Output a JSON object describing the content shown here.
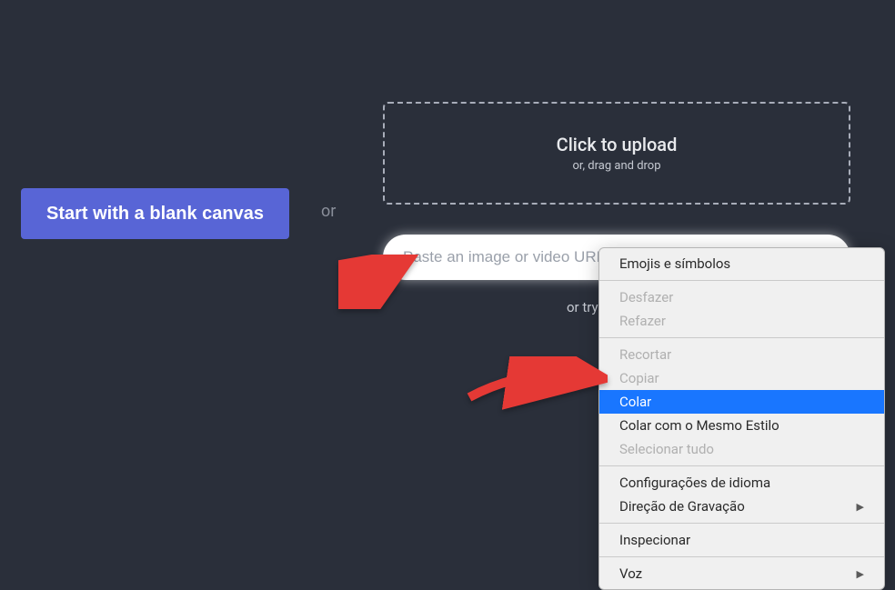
{
  "blank_canvas_label": "Start with a blank canvas",
  "or_label": "or",
  "upload": {
    "title": "Click to upload",
    "subtitle": "or, drag and drop"
  },
  "url_input_placeholder": "Paste an image or video URL",
  "or_try_label": "or try",
  "context_menu": {
    "emojis": "Emojis e símbolos",
    "desfazer": "Desfazer",
    "refazer": "Refazer",
    "recortar": "Recortar",
    "copiar": "Copiar",
    "colar": "Colar",
    "colar_estilo": "Colar com o Mesmo Estilo",
    "selecionar": "Selecionar tudo",
    "config_idioma": "Configurações de idioma",
    "direcao": "Direção de Gravação",
    "inspecionar": "Inspecionar",
    "voz": "Voz"
  }
}
